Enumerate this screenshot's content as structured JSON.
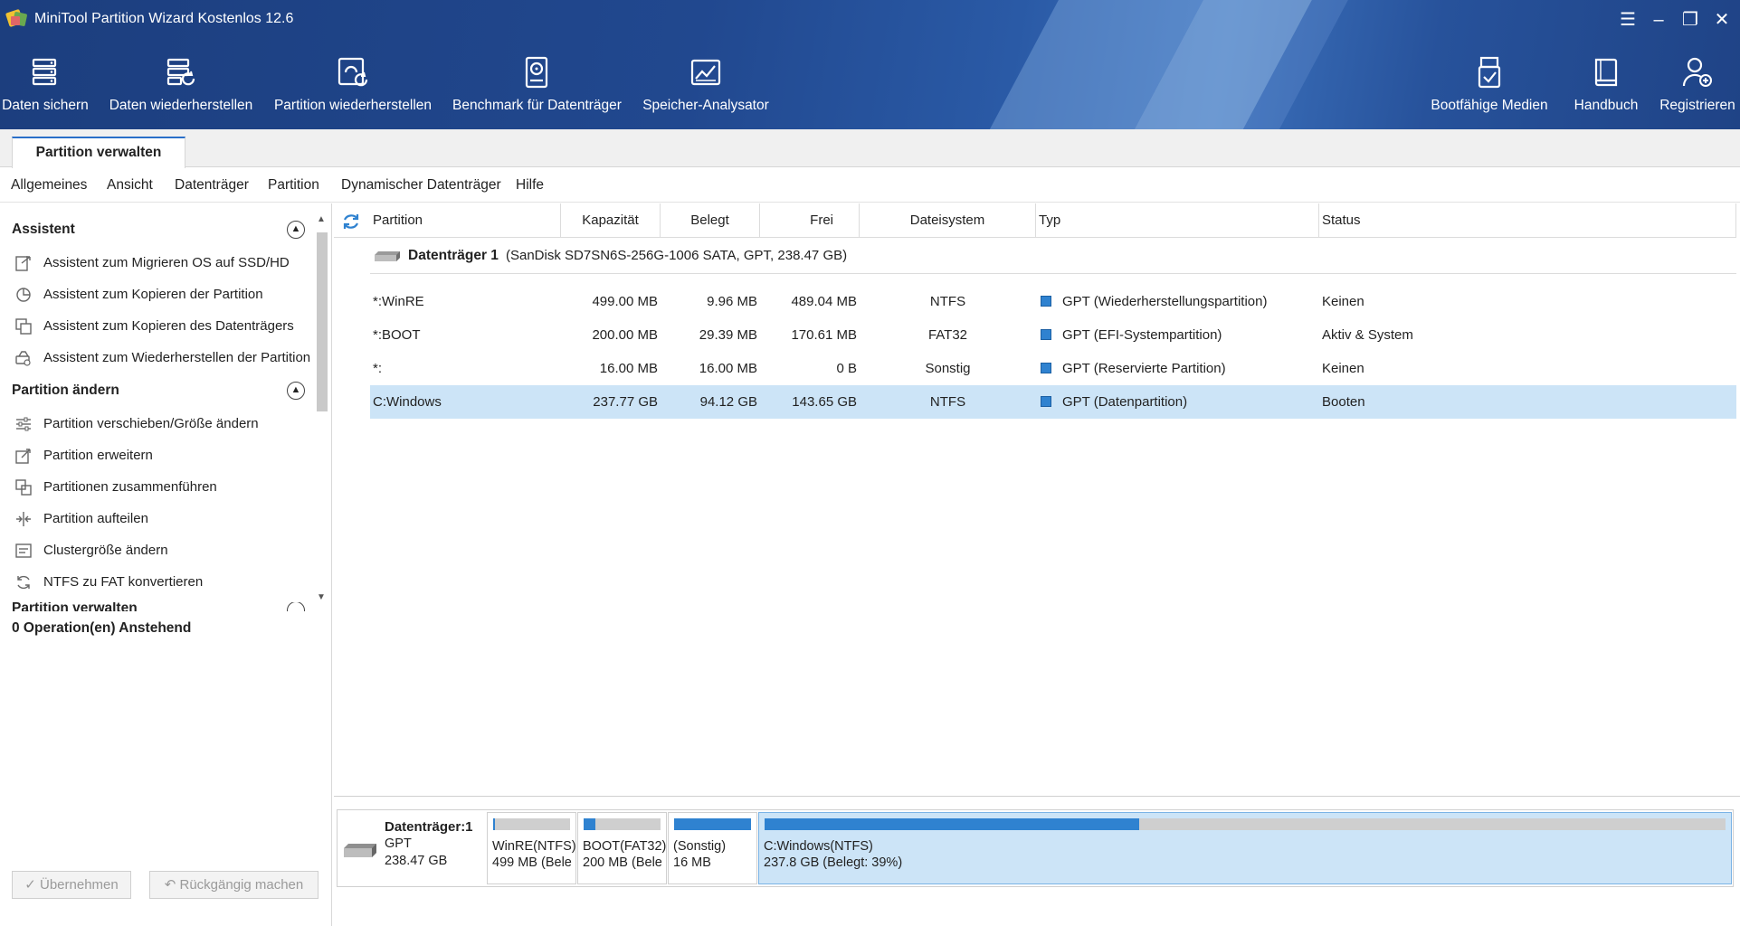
{
  "app": {
    "title": "MiniTool Partition Wizard Kostenlos 12.6"
  },
  "toolbar": {
    "backup": "Daten sichern",
    "recover_data": "Daten wiederherstellen",
    "recover_partition": "Partition wiederherstellen",
    "benchmark": "Benchmark für Datenträger",
    "space_analyzer": "Speicher-Analysator",
    "bootable_media": "Bootfähige Medien",
    "manual": "Handbuch",
    "register": "Registrieren"
  },
  "tabs": {
    "manage": "Partition verwalten"
  },
  "menu": [
    "Allgemeines",
    "Ansicht",
    "Datenträger",
    "Partition",
    "Dynamischer Datenträger",
    "Hilfe"
  ],
  "sidebar": {
    "wizard_title": "Assistent",
    "wizard_items": [
      "Assistent zum Migrieren OS auf SSD/HD",
      "Assistent zum Kopieren der Partition",
      "Assistent zum Kopieren des Datenträgers",
      "Assistent zum Wiederherstellen der Partition"
    ],
    "change_title": "Partition ändern",
    "change_items": [
      "Partition verschieben/Größe ändern",
      "Partition erweitern",
      "Partitionen zusammenführen",
      "Partition aufteilen",
      "Clustergröße ändern",
      "NTFS zu FAT konvertieren"
    ],
    "manage_title": "Partition verwalten",
    "pending": "0 Operation(en) Anstehend",
    "apply_button": "✓ Übernehmen",
    "undo_button": "↶ Rückgängig machen"
  },
  "table": {
    "headers": [
      "Partition",
      "Kapazität",
      "Belegt",
      "Frei",
      "Dateisystem",
      "Typ",
      "Status"
    ],
    "disk": {
      "name": "Datenträger 1",
      "detail": "(SanDisk SD7SN6S-256G-1006 SATA, GPT, 238.47 GB)"
    },
    "rows": [
      {
        "partition": "*:WinRE",
        "capacity": "499.00 MB",
        "used": "9.96 MB",
        "free": "489.04 MB",
        "fs": "NTFS",
        "type": "GPT (Wiederherstellungspartition)",
        "status": "Keinen"
      },
      {
        "partition": "*:BOOT",
        "capacity": "200.00 MB",
        "used": "29.39 MB",
        "free": "170.61 MB",
        "fs": "FAT32",
        "type": "GPT (EFI-Systempartition)",
        "status": "Aktiv & System"
      },
      {
        "partition": "*:",
        "capacity": "16.00 MB",
        "used": "16.00 MB",
        "free": "0 B",
        "fs": "Sonstig",
        "type": "GPT (Reservierte Partition)",
        "status": "Keinen"
      },
      {
        "partition": "C:Windows",
        "capacity": "237.77 GB",
        "used": "94.12 GB",
        "free": "143.65 GB",
        "fs": "NTFS",
        "type": "GPT (Datenpartition)",
        "status": "Booten"
      }
    ]
  },
  "diskmap": {
    "disk_label": "Datenträger:1",
    "disk_type": "GPT",
    "disk_size": "238.47 GB",
    "partitions": [
      {
        "line1": "WinRE(NTFS)",
        "line2": "499 MB (Bele",
        "used_fraction": 0.02
      },
      {
        "line1": "BOOT(FAT32)",
        "line2": "200 MB (Bele",
        "used_fraction": 0.15
      },
      {
        "line1": "(Sonstig)",
        "line2": "16 MB",
        "used_fraction": 1.0
      },
      {
        "line1": "C:Windows(NTFS)",
        "line2": "237.8 GB (Belegt: 39%)",
        "used_fraction": 0.39
      }
    ]
  },
  "colors": {
    "accent": "#2f82d0",
    "header": "#21488f",
    "selection": "#cce4f7"
  }
}
